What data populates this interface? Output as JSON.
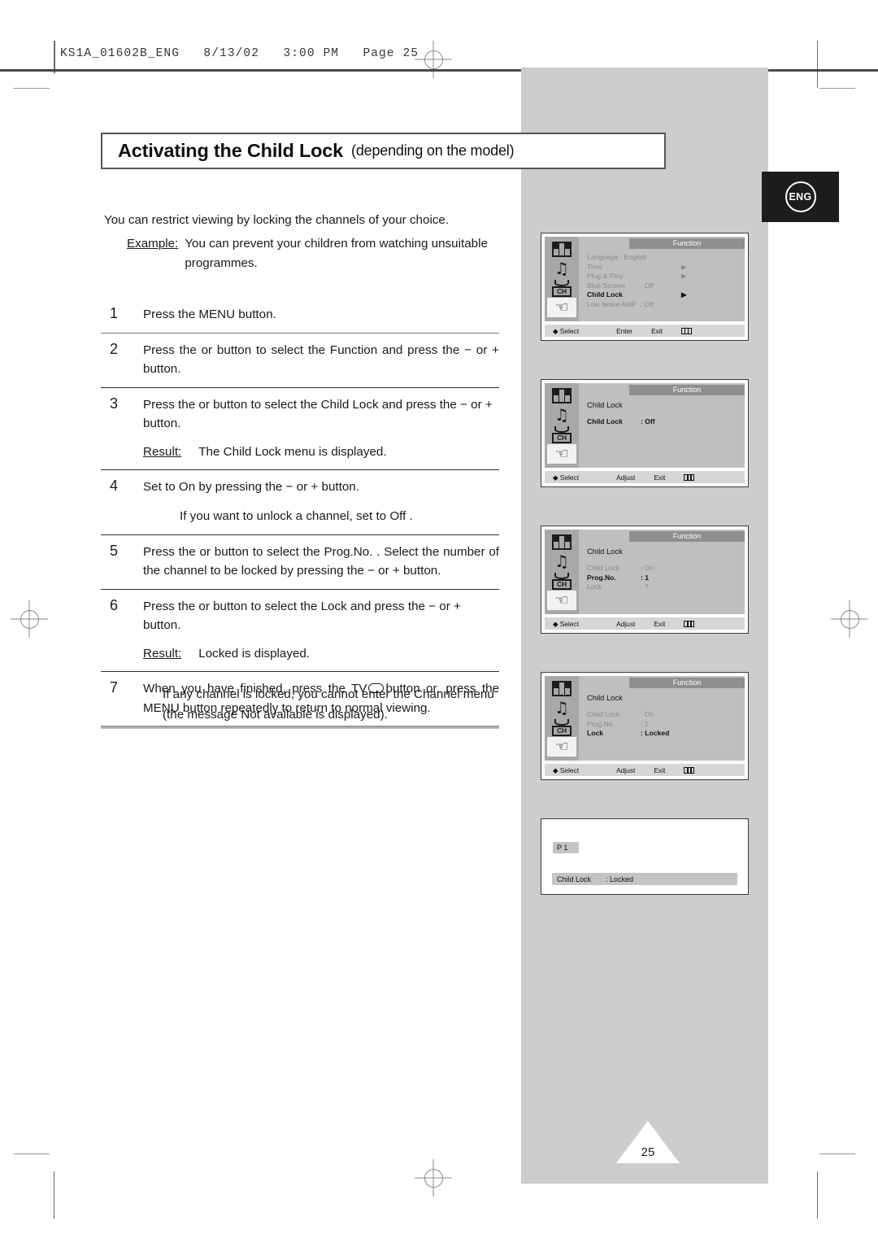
{
  "header": {
    "filename_line": "KS1A_01602B_ENG   8/13/02   3:00 PM   Page 25"
  },
  "badge": {
    "language": "ENG"
  },
  "title": {
    "main": "Activating the Child Lock",
    "sub": "(depending on the model)"
  },
  "intro": {
    "line1": "You can restrict viewing by locking the channels of your choice.",
    "example_label": "Example:",
    "example_body": "You can prevent your children from watching unsuitable programmes."
  },
  "steps": [
    {
      "num": "1",
      "body": "Press the MENU button."
    },
    {
      "num": "2",
      "body": "Press the    or    button to select the  Function  and press the − or + button."
    },
    {
      "num": "3",
      "body": "Press the    or    button to select the  Child Lock  and press the − or + button.",
      "result_label": "Result:",
      "result_value": "The  Child Lock  menu is displayed."
    },
    {
      "num": "4",
      "body": "Set to  On  by pressing the − or + button.",
      "substep": "If you want to unlock a channel, set to  Off ."
    },
    {
      "num": "5",
      "body": "Press the    or    button to select the  Prog.No. . Select the number of the channel to be locked by pressing the − or + button."
    },
    {
      "num": "6",
      "body": "Press the    or    button to select the  Lock  and press the − or + button.",
      "result_label": "Result:",
      "result_value": "Locked  is displayed."
    },
    {
      "num": "7",
      "body_before": "When  you  have  finished,  press  the  TV",
      "body_after": "button  or,  press  the MENU button repeatedly to return to normal viewing."
    }
  ],
  "note": {
    "text": "If any channel is locked, you cannot enter the  Channel  menu (the message  Not available  is displayed)."
  },
  "osd_sidebar_icons": [
    {
      "name": "picture-icon",
      "active": false
    },
    {
      "name": "sound-icon",
      "active": false
    },
    {
      "name": "channel-icon",
      "active": false
    },
    {
      "name": "function-icon",
      "active": true
    }
  ],
  "osd_screens": [
    {
      "tab": "Function",
      "rows": [
        {
          "key": "Language : English",
          "value": "",
          "arrow": "",
          "state": "dim",
          "full": true
        },
        {
          "key": "Time",
          "value": "",
          "arrow": "▶",
          "state": "dim"
        },
        {
          "key": "Plug & Play",
          "value": "",
          "arrow": "▶",
          "state": "dim"
        },
        {
          "key": "Blue Screen",
          "value": ": Off",
          "arrow": "",
          "state": "dim"
        },
        {
          "key": "Child Lock",
          "value": "",
          "arrow": "▶",
          "state": "hi"
        },
        {
          "key": "Low Noise AMP",
          "value": ": Off",
          "arrow": "",
          "state": "dim"
        }
      ],
      "bottom": {
        "select": "Select",
        "action": "Enter",
        "exit": "Exit"
      }
    },
    {
      "tab": "Function",
      "title": "Child Lock",
      "rows": [
        {
          "key": "Child Lock",
          "value": ": Off",
          "arrow": "",
          "state": "hi"
        }
      ],
      "bottom": {
        "select": "Select",
        "action": "Adjust",
        "exit": "Exit"
      }
    },
    {
      "tab": "Function",
      "title": "Child Lock",
      "rows": [
        {
          "key": "Child Lock",
          "value": ": On",
          "arrow": "",
          "state": "dim"
        },
        {
          "key": "Prog.No.",
          "value": ":  1",
          "arrow": "",
          "state": "hi"
        },
        {
          "key": "Lock",
          "value": ":  ?",
          "arrow": "",
          "state": "dim"
        }
      ],
      "bottom": {
        "select": "Select",
        "action": "Adjust",
        "exit": "Exit"
      }
    },
    {
      "tab": "Function",
      "title": "Child Lock",
      "rows": [
        {
          "key": "Child Lock",
          "value": ": On",
          "arrow": "",
          "state": "dim"
        },
        {
          "key": "Prog.No.",
          "value": ":  1",
          "arrow": "",
          "state": "dim"
        },
        {
          "key": "Lock",
          "value": ": Locked",
          "arrow": "",
          "state": "hi"
        }
      ],
      "bottom": {
        "select": "Select",
        "action": "Adjust",
        "exit": "Exit"
      }
    }
  ],
  "osd_final": {
    "prog_badge": "P 1",
    "status_key": "Child Lock",
    "status_value": ": Locked"
  },
  "page_number": "25"
}
